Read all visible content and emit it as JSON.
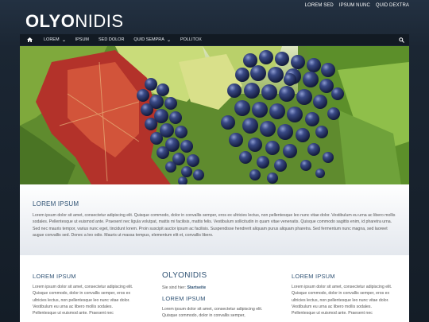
{
  "top_links": [
    "LOREM SED",
    "IPSUM NUNC",
    "QUID DEXTRA"
  ],
  "logo": {
    "bold": "OLYO",
    "light": "NIDIS"
  },
  "nav": {
    "home_icon": "home-icon",
    "items": [
      {
        "label": "LOREM",
        "dropdown": true
      },
      {
        "label": "IPSUM",
        "dropdown": false
      },
      {
        "label": "SED DOLOR",
        "dropdown": false
      },
      {
        "label": "QUID SEMPRA",
        "dropdown": true
      },
      {
        "label": "POLLITOX",
        "dropdown": false
      }
    ],
    "search_icon": "search-icon"
  },
  "intro": {
    "heading": "LOREM IPSUM",
    "text": "Lorem ipsum dolor sit amet, consectetur adipiscing elit. Quisque commodo, dolor in convallis semper, eros ex ultricies lectus, non pellentesque leo nunc vitae dolor. Vestibulum eu urna ac libero mollis sodales. Pellentesque ut euismod ante. Praesent nec ligula volutpat, mattis mi facilisis, mattis felis. Vestibulum sollicitudin in quam vitae venenatis. Quisque commodo sagittis enim, id pharetra urna. Sed nec mauris tempor, varius nunc eget, tincidunt lorem. Proin suscipit auctor ipsum ac facilisis. Suspendisse hendrerit aliquam purus aliquam pharetra. Sed fermentum nunc magna, sed laoreet augue convallis sed. Donec a leo odio. Mauris ut massa tempus, elementum elit et, convallis libero."
  },
  "columns": {
    "left": {
      "heading": "LOREM IPSUM",
      "text": "Lorem ipsum dolor sit amet, consectetur adipiscing elit. Quisque commodo, dolor in convallis semper, eros ex ultricies lectus, non pellentesque leo nunc vitae dolor. Vestibulum eu urna ac libero mollis sodales. Pellentesque ut euismod ante. Praesent nec"
    },
    "middle": {
      "title": "OLYONIDIS",
      "breadcrumb_prefix": "Sie sind hier:",
      "breadcrumb_link": "Startseite",
      "heading": "LOREM IPSUM",
      "text": "Lorem ipsum dolor sit amet, consectetur adipiscing elit. Quisque commodo, dolor in convallis semper,"
    },
    "right": {
      "heading": "LOREM IPSUM",
      "text": "Lorem ipsum dolor sit amet, consectetur adipiscing elit. Quisque commodo, dolor in convallis semper, eros ex ultricies lectus, non pellentesque leo nunc vitae dolor. Vestibulum eu urna ac libero mollis sodales. Pellentesque ut euismod ante. Praesent nec"
    }
  },
  "colors": {
    "accent": "#2f5274",
    "navbar": "#121a23",
    "page_bg": "#1e2a38"
  }
}
